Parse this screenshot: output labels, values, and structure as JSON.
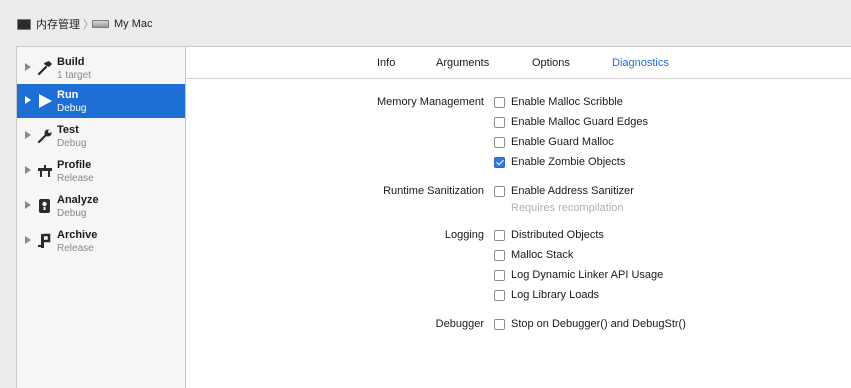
{
  "breadcrumb": {
    "scheme": "内存管理",
    "destination": "My Mac"
  },
  "sidebar": {
    "items": [
      {
        "title": "Build",
        "subtitle": "1 target",
        "icon": "hammer-icon",
        "selected": false
      },
      {
        "title": "Run",
        "subtitle": "Debug",
        "icon": "play-icon",
        "selected": true
      },
      {
        "title": "Test",
        "subtitle": "Debug",
        "icon": "wrench-icon",
        "selected": false
      },
      {
        "title": "Profile",
        "subtitle": "Release",
        "icon": "instruments-icon",
        "selected": false
      },
      {
        "title": "Analyze",
        "subtitle": "Debug",
        "icon": "analyze-icon",
        "selected": false
      },
      {
        "title": "Archive",
        "subtitle": "Release",
        "icon": "archive-icon",
        "selected": false
      }
    ]
  },
  "tabs": [
    {
      "label": "Info",
      "active": false
    },
    {
      "label": "Arguments",
      "active": false
    },
    {
      "label": "Options",
      "active": false
    },
    {
      "label": "Diagnostics",
      "active": true
    }
  ],
  "diagnostics": {
    "memory_management": {
      "label": "Memory Management",
      "options": [
        {
          "label": "Enable Malloc Scribble",
          "checked": false
        },
        {
          "label": "Enable Malloc Guard Edges",
          "checked": false
        },
        {
          "label": "Enable Guard Malloc",
          "checked": false
        },
        {
          "label": "Enable Zombie Objects",
          "checked": true
        }
      ]
    },
    "runtime_sanitization": {
      "label": "Runtime Sanitization",
      "options": [
        {
          "label": "Enable Address Sanitizer",
          "checked": false
        }
      ],
      "hint": "Requires recompilation"
    },
    "logging": {
      "label": "Logging",
      "options": [
        {
          "label": "Distributed Objects",
          "checked": false
        },
        {
          "label": "Malloc Stack",
          "checked": false
        },
        {
          "label": "Log Dynamic Linker API Usage",
          "checked": false
        },
        {
          "label": "Log Library Loads",
          "checked": false
        }
      ]
    },
    "debugger": {
      "label": "Debugger",
      "options": [
        {
          "label": "Stop on Debugger() and DebugStr()",
          "checked": false
        }
      ]
    }
  },
  "colors": {
    "accent": "#1d6fd6",
    "checkbox_checked": "#2f7ae5",
    "window_bg": "#ececec"
  }
}
